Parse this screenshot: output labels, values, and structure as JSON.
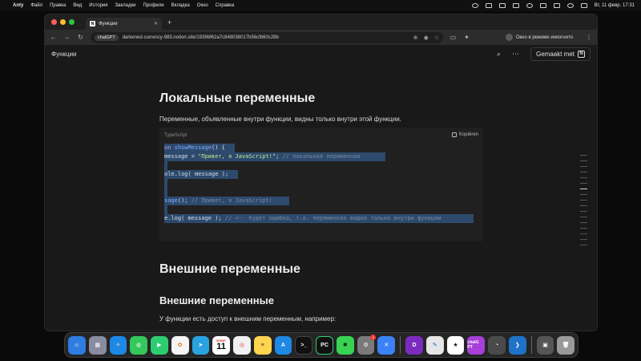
{
  "menubar": {
    "app": "Anty",
    "items": [
      "Файл",
      "Правка",
      "Вид",
      "История",
      "Закладки",
      "Профили",
      "Вкладка",
      "Окно",
      "Справка"
    ],
    "clock": "Вт, 11 февр.  17:31"
  },
  "browser": {
    "tab_title": "Функции",
    "tab_favicon": "N",
    "new_tab": "+",
    "url_chip": "chatGPT",
    "url": "darkened-currency-983.notion.site/1939bf62a7c848038017b56cfb60c28b",
    "incognito_label": "Окно в режиме инкогнито"
  },
  "notion": {
    "breadcrumb": "Функции",
    "made_with": "Gemaakt met",
    "heading1": "Локальные переменные",
    "paragraph1": "Переменные, объявленные внутри функции, видны только внутри этой функции.",
    "code": {
      "language": "TypeScript",
      "copy_label": "Kopiëren"
    },
    "heading2": "Внешние переменные",
    "heading3": "Внешние переменные",
    "paragraph2": "У функции есть доступ к внешним переменным, например:"
  },
  "dock": {
    "calendar_month": "ФЕВР.",
    "calendar_day": "11",
    "apps": [
      "finder",
      "launchpad",
      "safari",
      "messages",
      "facetime",
      "photos",
      "telegram",
      "calendar",
      "chrome",
      "notes",
      "appstore",
      "terminal",
      "pycharm",
      "chatgpt-green",
      "settings",
      "vscode-like",
      "draw",
      "dock-app",
      "anki",
      "chatgpt",
      "instruments",
      "vscode",
      "preview",
      "trash"
    ],
    "chatgpt_label": "chatG PT",
    "settings_badge": "1"
  },
  "colors": {
    "selection": "#2d4a6d",
    "keyword": "#c792ea",
    "function": "#82aaff",
    "string": "#c3e88d",
    "comment": "#7a8aa0"
  }
}
